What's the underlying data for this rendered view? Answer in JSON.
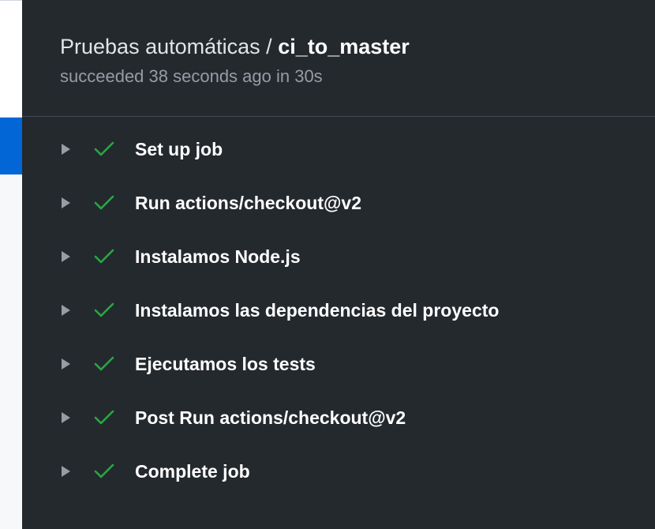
{
  "header": {
    "workflow_name": "Pruebas automáticas",
    "separator": "/",
    "job_name": "ci_to_master",
    "status_text": "succeeded 38 seconds ago in 30s"
  },
  "colors": {
    "panel_bg": "#24292e",
    "success_green": "#28a745",
    "active_blue": "#0366d6"
  },
  "steps": [
    {
      "label": "Set up job",
      "status": "success",
      "icon": "check-icon"
    },
    {
      "label": "Run actions/checkout@v2",
      "status": "success",
      "icon": "check-icon"
    },
    {
      "label": "Instalamos Node.js",
      "status": "success",
      "icon": "check-icon"
    },
    {
      "label": "Instalamos las dependencias del proyecto",
      "status": "success",
      "icon": "check-icon"
    },
    {
      "label": "Ejecutamos los tests",
      "status": "success",
      "icon": "check-icon"
    },
    {
      "label": "Post Run actions/checkout@v2",
      "status": "success",
      "icon": "check-icon"
    },
    {
      "label": "Complete job",
      "status": "success",
      "icon": "check-icon"
    }
  ]
}
